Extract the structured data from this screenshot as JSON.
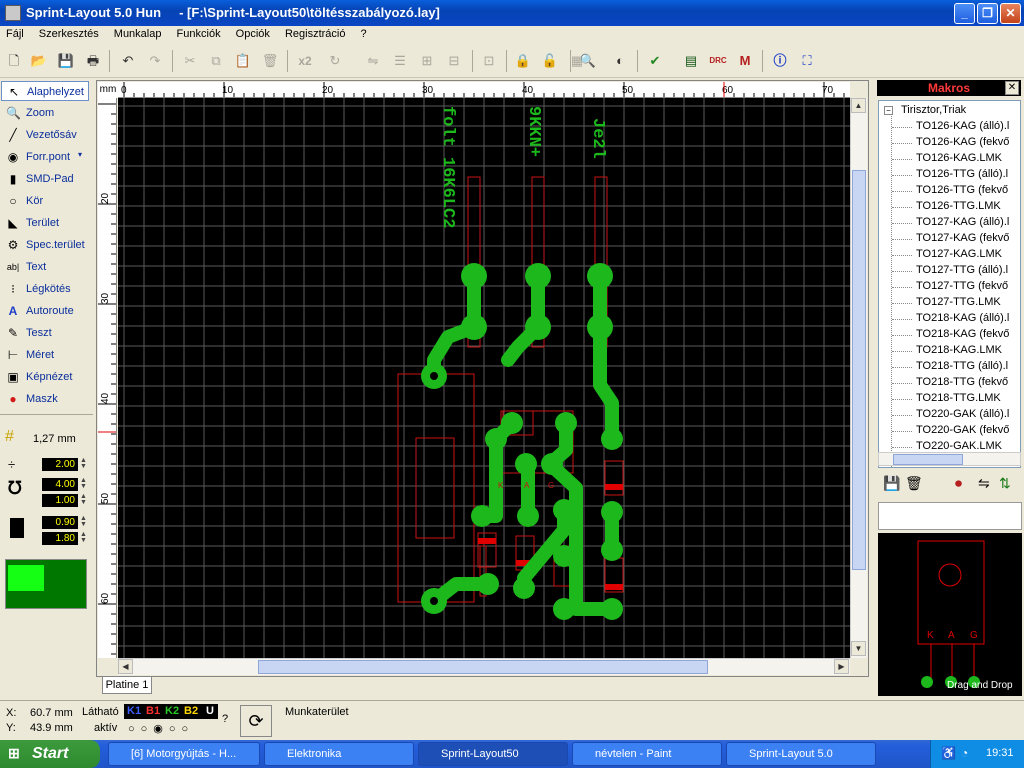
{
  "window": {
    "title": "Sprint-Layout 5.0 Hun     - [F:\\Sprint-Layout50\\töltésszabályozó.lay]",
    "min": "_",
    "max": "❐",
    "close": "✕"
  },
  "menu": [
    "Fájl",
    "Szerkesztés",
    "Munkalap",
    "Funkciók",
    "Opciók",
    "Regisztráció",
    "?"
  ],
  "toolbar_icons": [
    "new-icon",
    "open-icon",
    "save-icon",
    "print-icon",
    "undo-icon",
    "redo-icon",
    "cut-icon",
    "copy-icon",
    "paste-icon",
    "delete-icon",
    "x2-icon",
    "rotate-icon",
    "mirror-icon",
    "align-icon",
    "group-icon",
    "ungroup-icon",
    "component-icon",
    "lock-icon",
    "unlock-icon",
    "grid-icon",
    "zoom-icon",
    "contrast-icon",
    "autoroute-icon",
    "gerber-icon",
    "drc-icon",
    "macro-icon",
    "info-icon",
    "crop-icon"
  ],
  "toolbar_x2": "x2",
  "tools": [
    {
      "label": "Alaphelyzet",
      "icon": "arrow-icon",
      "glyph": "↖"
    },
    {
      "label": "Zoom",
      "icon": "zoom-icon",
      "glyph": "🔍"
    },
    {
      "label": "Vezetősáv",
      "icon": "track-icon",
      "glyph": "╱"
    },
    {
      "label": "Forr.pont",
      "icon": "pad-icon",
      "glyph": "◉"
    },
    {
      "label": "SMD-Pad",
      "icon": "smd-pad-icon",
      "glyph": "▮"
    },
    {
      "label": "Kör",
      "icon": "circle-icon",
      "glyph": "○"
    },
    {
      "label": "Terület",
      "icon": "area-icon",
      "glyph": "◣"
    },
    {
      "label": "Spec.terület",
      "icon": "special-area-icon",
      "glyph": "⚙"
    },
    {
      "label": "Text",
      "icon": "text-icon",
      "glyph": "ab|"
    },
    {
      "label": "Légkötés",
      "icon": "airwire-icon",
      "glyph": "⁝"
    },
    {
      "label": "Autoroute",
      "icon": "autoroute-icon",
      "glyph": "A"
    },
    {
      "label": "Teszt",
      "icon": "test-icon",
      "glyph": "✎"
    },
    {
      "label": "Méret",
      "icon": "measure-icon",
      "glyph": "⊢"
    },
    {
      "label": "Képnézet",
      "icon": "camera-icon",
      "glyph": "▣"
    },
    {
      "label": "Maszk",
      "icon": "mask-icon",
      "glyph": "●"
    }
  ],
  "grid_label": "1,27 mm",
  "params": [
    "2.00",
    "4.00",
    "1.00",
    "0.90",
    "1.80"
  ],
  "ruler_h": [
    "0",
    "10",
    "20",
    "30",
    "40",
    "50",
    "60",
    "70"
  ],
  "ruler_v": [
    "20",
    "30",
    "40",
    "50",
    "60"
  ],
  "ruler_corner": "mm",
  "tab": "Platine 1",
  "pcb_texts": [
    "folt 16K6LC2",
    "9KKN+",
    "Je2l"
  ],
  "pcb_markers": [
    "K",
    "A",
    "G"
  ],
  "macros": {
    "title": "Makros",
    "root": "Tirisztor,Triak",
    "items": [
      "TO126-KAG (álló).l",
      "TO126-KAG (fekvő",
      "TO126-KAG.LMK",
      "TO126-TTG (álló).l",
      "TO126-TTG (fekvő",
      "TO126-TTG.LMK",
      "TO127-KAG (álló).l",
      "TO127-KAG (fekvő",
      "TO127-KAG.LMK",
      "TO127-TTG (álló).l",
      "TO127-TTG (fekvő",
      "TO127-TTG.LMK",
      "TO218-KAG (álló).l",
      "TO218-KAG (fekvő",
      "TO218-KAG.LMK",
      "TO218-TTG (álló).l",
      "TO218-TTG (fekvő",
      "TO218-TTG.LMK",
      "TO220-GAK (álló).l",
      "TO220-GAK (fekvő",
      "TO220-GAK.LMK"
    ],
    "preview_labels": [
      "K",
      "A",
      "G"
    ],
    "drag_label": "Drag and Drop"
  },
  "status": {
    "x_label": "X:",
    "x": "60.7 mm",
    "y_label": "Y:",
    "y": "43.9 mm",
    "visible_label": "Látható",
    "active_label": "aktív",
    "layers": [
      "K1",
      "B1",
      "K2",
      "B2",
      "U"
    ],
    "layer_colors": [
      "#3c5cff",
      "#ff3030",
      "#28c828",
      "#ffd800",
      "#ffffff"
    ],
    "question": "?",
    "workspace": "Munkaterület"
  },
  "taskbar": {
    "start": "Start",
    "tasks": [
      "[6] Motorgyújtás - H...",
      "Elektronika",
      "Sprint-Layout50",
      "névtelen - Paint",
      "Sprint-Layout 5.0"
    ],
    "clock": "19:31"
  },
  "colors": {
    "copper": "#1cb81c",
    "silk": "#c81414",
    "grid": "#5a5a5a",
    "text": "#1cb81c"
  }
}
